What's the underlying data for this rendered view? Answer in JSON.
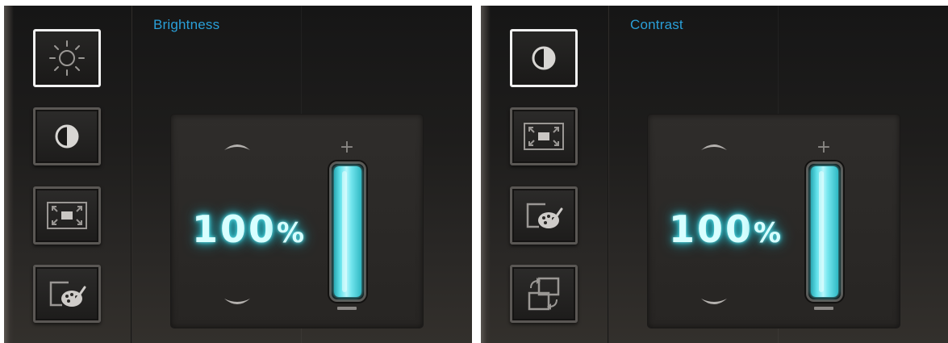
{
  "panels": [
    {
      "title": "Brightness",
      "value": "100",
      "unit": "%",
      "level_fraction": 1.0,
      "buttons": [
        {
          "name": "brightness-button",
          "icon": "sun-icon",
          "active": true
        },
        {
          "name": "contrast-button",
          "icon": "contrast-icon",
          "active": false
        },
        {
          "name": "aspect-ratio-button",
          "icon": "aspect-ratio-icon",
          "active": false
        },
        {
          "name": "color-settings-button",
          "icon": "palette-icon",
          "active": false
        }
      ]
    },
    {
      "title": "Contrast",
      "value": "100",
      "unit": "%",
      "level_fraction": 1.0,
      "buttons": [
        {
          "name": "contrast-button",
          "icon": "contrast-icon",
          "active": true
        },
        {
          "name": "aspect-ratio-button",
          "icon": "aspect-ratio-icon",
          "active": false
        },
        {
          "name": "color-settings-button",
          "icon": "palette-icon",
          "active": false
        },
        {
          "name": "input-source-button",
          "icon": "rotate-screens-icon",
          "active": false
        }
      ]
    }
  ],
  "colors": {
    "title": "#2a9fd8",
    "glow": "#5fe3ec",
    "active_border": "#f2f2f2"
  },
  "controls": {
    "plus_symbol": "+"
  }
}
